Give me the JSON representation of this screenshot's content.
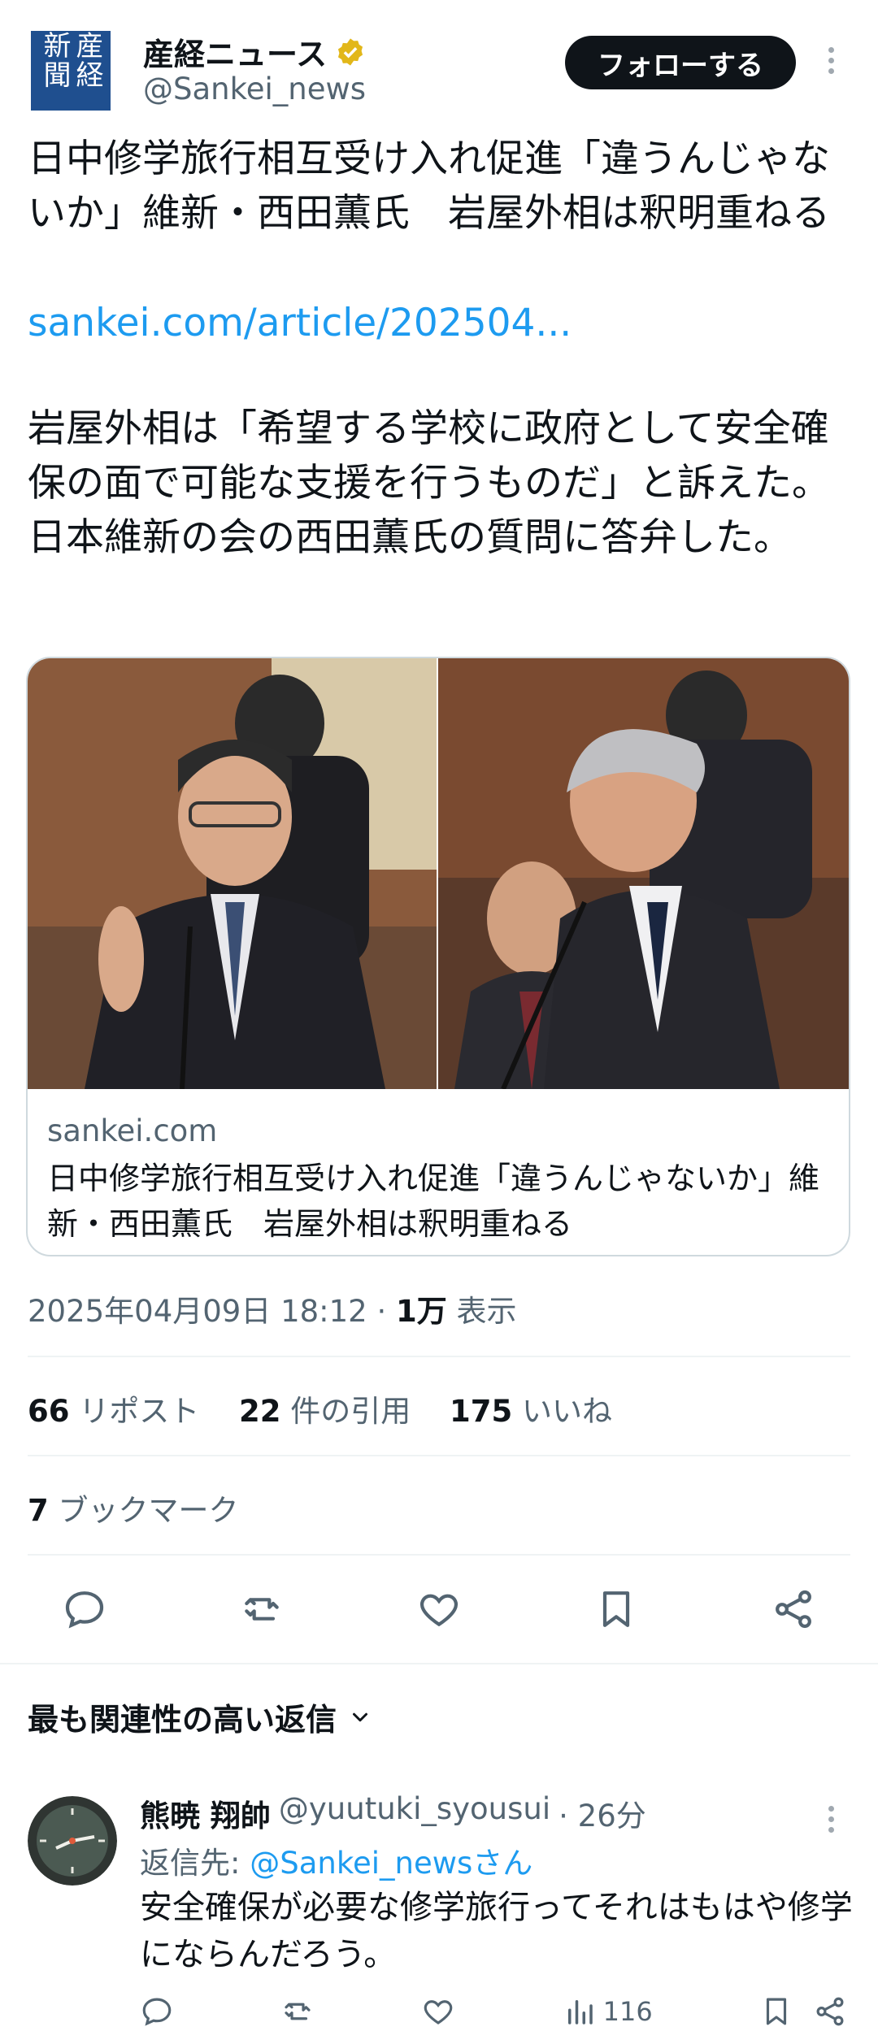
{
  "account": {
    "name": "産経ニュース",
    "handle": "@Sankei_news",
    "logo_text": "産経新聞",
    "follow_label": "フォローする"
  },
  "post": {
    "headline": "日中修学旅行相互受け入れ促進「違うんじゃないか」維新・西田薫氏　岩屋外相は釈明重ねる",
    "link": "sankei.com/article/202504...",
    "body": "岩屋外相は「希望する学校に政府として安全確保の面で可能な支援を行うものだ」と訴えた。日本維新の会の西田薫氏の質問に答弁した。",
    "card": {
      "domain": "sankei.com",
      "title": "日中修学旅行相互受け入れ促進「違うんじゃないか」維新・西田薫氏　岩屋外相は釈明重ねる"
    },
    "timestamp": "2025年04月09日 18:12",
    "views_count": "1万",
    "views_label": "表示",
    "stats": {
      "reposts_count": "66",
      "reposts_label": "リポスト",
      "quotes_count": "22",
      "quotes_label": "件の引用",
      "likes_count": "175",
      "likes_label": "いいね",
      "bookmarks_count": "7",
      "bookmarks_label": "ブックマーク"
    }
  },
  "replies_section": {
    "title": "最も関連性の高い返信"
  },
  "reply": {
    "name": "熊暁 翔帥",
    "handle": "@yuutuki_syousui",
    "time": "· 26分",
    "reply_to_prefix": "返信先: ",
    "reply_to_handle": "@Sankei_newsさん",
    "text": "安全確保が必要な修学旅行ってそれはもはや修学にならんだろう。",
    "views": "116"
  },
  "colors": {
    "link": "#1d9bf0",
    "muted": "#536471",
    "text": "#0f1419",
    "logo": "#1f4f8f",
    "verified": "#e2b719"
  }
}
